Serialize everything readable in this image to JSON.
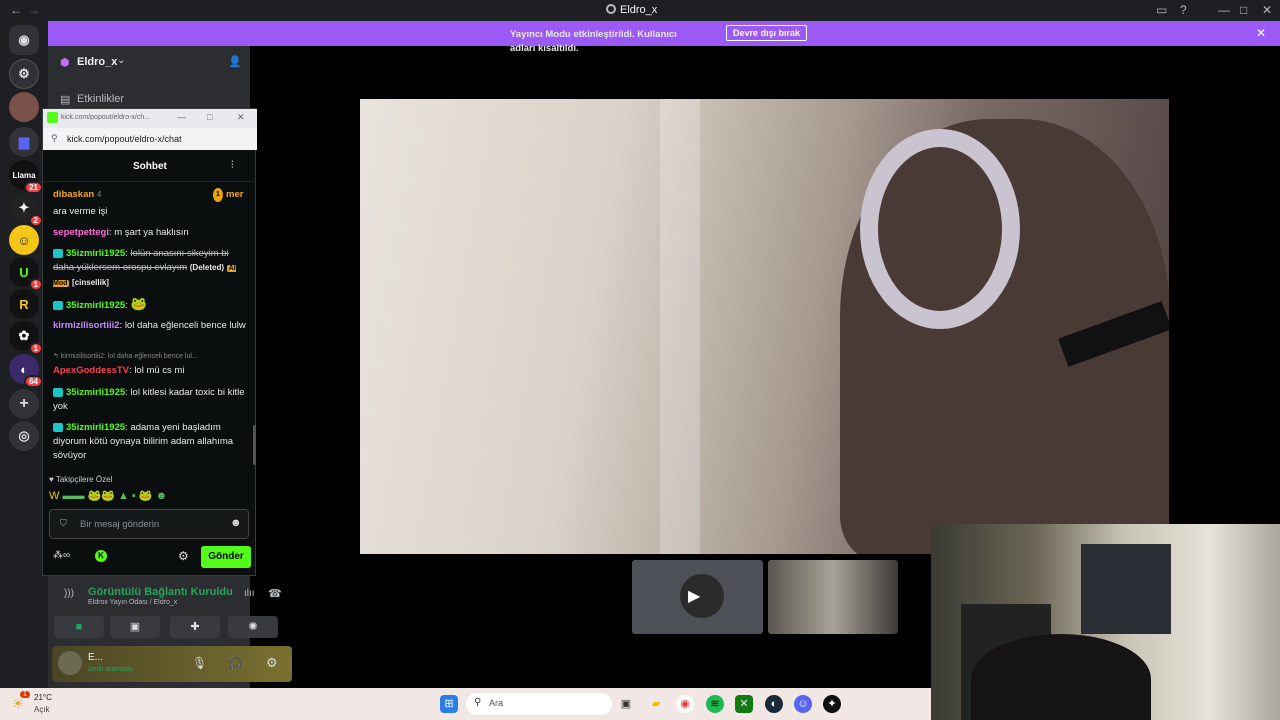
{
  "window": {
    "title": "Eldro_x"
  },
  "banner": {
    "message": "Yayıncı Modu etkinleştirildi. Kullanıcı adları kısaltıldı.",
    "button": "Devre dışı bırak"
  },
  "servers": [
    {
      "badge": ""
    },
    {
      "badge": ""
    },
    {
      "badge": "21"
    },
    {
      "badge": "2"
    },
    {
      "badge": ""
    },
    {
      "badge": "1"
    },
    {
      "badge": ""
    },
    {
      "badge": "1"
    },
    {
      "badge": "64"
    }
  ],
  "sidebar": {
    "server_name": "Eldro_x",
    "events_label": "Etkinlikler"
  },
  "popup": {
    "window_title": "kick.com/popout/eldro-x/ch...",
    "url": "kick.com/popout/eldro-x/chat",
    "chat_title": "Sohbet",
    "pinned_user": "dibaskan",
    "pinned_count": "4",
    "pinned_badge": "mer",
    "messages": [
      {
        "text": "ara verme işi"
      },
      {
        "user": "sepetpettegi",
        "text": "m şart ya haklısın"
      },
      {
        "user": "35izmirli1925",
        "text": "lolün anasını sikeyim bi daha yüklersem orospu evlayım",
        "deleted": "(Deleted)",
        "mod": "AI Mod",
        "tag": "[cinsellik]"
      },
      {
        "user": "35izmirli1925",
        "text": ""
      },
      {
        "user": "kirmizilisortiii2",
        "text": "lol daha eğlenceli bence lulw"
      },
      {
        "reply": "kirmizilisortiii2: lol daha eğlenceli bence lul...",
        "user": "ApexGoddessTV",
        "text": "lol mü cs mi"
      },
      {
        "user": "35izmirli1925",
        "text": "lol kitlesi kadar toxic bi kitle yok"
      },
      {
        "user": "35izmirli1925",
        "text": "adama yeni başladım diyorum kötü oynaya bilirim adam allahıma sövüyor"
      }
    ],
    "followers_label": "Takipçilere Özel",
    "input_placeholder": "Bir mesaj gönderin",
    "send": "Gönder"
  },
  "voice": {
    "status": "Görüntülü Bağlantı Kuruldu",
    "channel": "Eldrox Yayın Odası / Eldro_x"
  },
  "user": {
    "name": "E...",
    "status": "Sesli aramada"
  },
  "taskbar": {
    "temperature": "21°C",
    "condition": "Açık",
    "weather_badge": "1",
    "search": "Ara"
  },
  "colors": {
    "banner": "#9b59f5",
    "kick_green": "#53fc18",
    "voice_green": "#23a55a"
  }
}
